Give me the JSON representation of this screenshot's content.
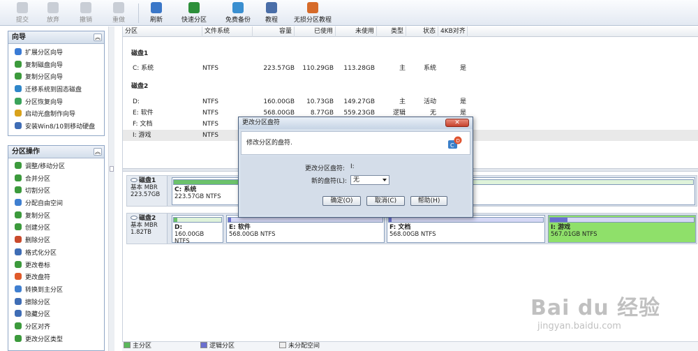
{
  "toolbar": {
    "items": [
      {
        "label": "提交",
        "state": "disabled",
        "icon": "commit-icon"
      },
      {
        "label": "放弃",
        "state": "disabled",
        "icon": "discard-icon"
      },
      {
        "label": "撤销",
        "state": "disabled",
        "icon": "undo-icon"
      },
      {
        "label": "重做",
        "state": "disabled",
        "icon": "redo-icon"
      },
      {
        "label": "刷新",
        "state": "enabled",
        "icon": "refresh-icon",
        "color": "#3a77c8"
      },
      {
        "label": "快速分区",
        "state": "enabled",
        "icon": "quick-partition-icon",
        "color": "#2c8f3a"
      },
      {
        "label": "免费备份",
        "state": "enabled",
        "icon": "backup-icon",
        "color": "#3a8fd0"
      },
      {
        "label": "教程",
        "state": "enabled",
        "icon": "tutorial-icon",
        "color": "#4a6ea8"
      },
      {
        "label": "无损分区教程",
        "state": "enabled",
        "icon": "lossless-tutorial-icon",
        "color": "#d66b2a"
      }
    ]
  },
  "sidebar": {
    "wizard": {
      "title": "向导",
      "items": [
        {
          "label": "扩展分区向导",
          "color": "#3a7bd5"
        },
        {
          "label": "复制磁盘向导",
          "color": "#3c9a3c"
        },
        {
          "label": "复制分区向导",
          "color": "#3c9a3c"
        },
        {
          "label": "迁移系统到固态磁盘",
          "color": "#2f86c9"
        },
        {
          "label": "分区恢复向导",
          "color": "#3aa35b"
        },
        {
          "label": "启动光盘制作向导",
          "color": "#d9a21b"
        },
        {
          "label": "安装Win8/10到移动硬盘",
          "color": "#3f6db5"
        }
      ]
    },
    "operations": {
      "title": "分区操作",
      "items": [
        {
          "label": "调整/移动分区",
          "color": "#3c9a3c"
        },
        {
          "label": "合并分区",
          "color": "#3c9a3c"
        },
        {
          "label": "切割分区",
          "color": "#3c9a3c"
        },
        {
          "label": "分配自由空间",
          "color": "#3f7fd0"
        },
        {
          "label": "复制分区",
          "color": "#3c9a3c"
        },
        {
          "label": "创建分区",
          "color": "#3c9a3c"
        },
        {
          "label": "删除分区",
          "color": "#c94a2c"
        },
        {
          "label": "格式化分区",
          "color": "#3f6db5"
        },
        {
          "label": "更改卷标",
          "color": "#3c9a3c"
        },
        {
          "label": "更改盘符",
          "color": "#e05a2a"
        },
        {
          "label": "转换到主分区",
          "color": "#3f7fd0"
        },
        {
          "label": "擦除分区",
          "color": "#3f6db5"
        },
        {
          "label": "隐藏分区",
          "color": "#3f6db5"
        },
        {
          "label": "分区对齐",
          "color": "#3c9a3c"
        },
        {
          "label": "更改分区类型",
          "color": "#3c9a3c"
        }
      ]
    }
  },
  "table": {
    "columns": [
      "分区",
      "文件系统",
      "容量",
      "已使用",
      "未使用",
      "类型",
      "状态",
      "4KB对齐"
    ],
    "disk1": {
      "title": "磁盘1",
      "rows": [
        {
          "partition": "C: 系统",
          "fs": "NTFS",
          "capacity": "223.57GB",
          "used": "110.29GB",
          "free": "113.28GB",
          "type": "主",
          "status": "系统",
          "align": "是"
        }
      ]
    },
    "disk2": {
      "title": "磁盘2",
      "rows": [
        {
          "partition": "D:",
          "fs": "NTFS",
          "capacity": "160.00GB",
          "used": "10.73GB",
          "free": "149.27GB",
          "type": "主",
          "status": "活动",
          "align": "是"
        },
        {
          "partition": "E: 软件",
          "fs": "NTFS",
          "capacity": "568.00GB",
          "used": "8.77GB",
          "free": "559.23GB",
          "type": "逻辑",
          "status": "无",
          "align": "是"
        },
        {
          "partition": "F: 文档",
          "fs": "NTFS",
          "capacity": "",
          "used": "",
          "free": "",
          "type": "",
          "status": "",
          "align": ""
        },
        {
          "partition": "I: 游戏",
          "fs": "NTFS",
          "capacity": "",
          "used": "",
          "free": "",
          "type": "",
          "status": "",
          "align": ""
        }
      ]
    }
  },
  "diskmap": {
    "disk1": {
      "name": "磁盘1",
      "scheme": "基本 MBR",
      "size": "223.57GB",
      "parts": [
        {
          "label": "C: 系统",
          "info": "223.57GB NTFS",
          "fill": 0.49,
          "color": "#6cc26b"
        }
      ]
    },
    "disk2": {
      "name": "磁盘2",
      "scheme": "基本 MBR",
      "size": "1.82TB",
      "parts": [
        {
          "label": "D:",
          "info": "160.00GB NTFS",
          "fill": 0.07,
          "color": "#6cc26b"
        },
        {
          "label": "E: 软件",
          "info": "568.00GB NTFS",
          "fill": 0.02,
          "color": "#6a6fcf"
        },
        {
          "label": "F: 文档",
          "info": "568.00GB NTFS",
          "fill": 0.02,
          "color": "#6a6fcf"
        },
        {
          "label": "I: 游戏",
          "info": "567.01GB NTFS",
          "fill": 0.12,
          "color": "#6a6fcf",
          "selected": true
        }
      ]
    }
  },
  "legend": [
    {
      "label": "主分区",
      "color": "#5ab85a"
    },
    {
      "label": "逻辑分区",
      "color": "#6a6fcf"
    },
    {
      "label": "未分配空间",
      "color": "#eeeeee"
    }
  ],
  "dialog": {
    "title": "更改分区盘符",
    "close": "✕",
    "subtitle": "修改分区的盘符.",
    "current_label": "更改分区盘符:",
    "current_value": "I:",
    "new_label": "新的盘符(L):",
    "new_value": "无",
    "ok": "确定(O)",
    "cancel": "取消(C)",
    "help": "帮助(H)"
  },
  "watermark": {
    "brand": "Bai du 经验",
    "url": "jingyan.baidu.com"
  }
}
